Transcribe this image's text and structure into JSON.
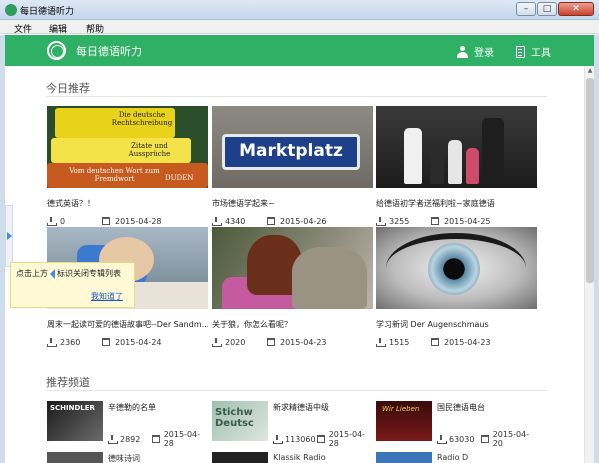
{
  "window": {
    "title": "每日德语听力",
    "buttons": {
      "minimize": "–",
      "maximize": "□",
      "close": "✕"
    }
  },
  "menu": [
    "文件",
    "编辑",
    "帮助"
  ],
  "header": {
    "app_title": "每日德语听力",
    "login_label": "登录",
    "tools_label": "工具",
    "accent_color": "#2fb165"
  },
  "today": {
    "section_title": "今日推荐",
    "cards": [
      {
        "title": "德式英语？！",
        "downloads": "0",
        "date": "2015-04-28",
        "thumb_text": [
          "Die deutsche Rechtschreibung",
          "Zitate und Aussprüche",
          "Vom deutschen Wort zum Fremdwort",
          "DUDEN"
        ]
      },
      {
        "title": "市场德语学起来~",
        "downloads": "4340",
        "date": "2015-04-26",
        "thumb_text": [
          "Marktplatz"
        ]
      },
      {
        "title": "给德语初学者送福利啦~家庭德语",
        "downloads": "3255",
        "date": "2015-04-25",
        "thumb_text": []
      },
      {
        "title": "周末一起读可爱的德语故事吧--Der Sandm...",
        "downloads": "2360",
        "date": "2015-04-24",
        "thumb_text": []
      },
      {
        "title": "关于狼，你怎么看呢？",
        "downloads": "2020",
        "date": "2015-04-23",
        "thumb_text": []
      },
      {
        "title": "学习新词 Der Augenschmaus",
        "downloads": "1515",
        "date": "2015-04-23",
        "thumb_text": []
      }
    ]
  },
  "channels": {
    "section_title": "推荐频道",
    "items": [
      {
        "name": "辛德勒的名单",
        "downloads": "2892",
        "date": "2015-04-28",
        "thumb_text": "SCHINDLER"
      },
      {
        "name": "新求精德语中级",
        "downloads": "113060",
        "date": "2015-04-28",
        "thumb_text": "Stichw Deutsc"
      },
      {
        "name": "国民德语电台",
        "downloads": "63030",
        "date": "2015-04-20",
        "thumb_text": "Wir Lieben"
      }
    ],
    "partial_items": [
      "德味诗词",
      "Klassik Radio",
      "Radio D"
    ]
  },
  "tooltip": {
    "text_before": "点击上方",
    "text_after": "标识关闭专辑列表",
    "link": "我知道了"
  }
}
